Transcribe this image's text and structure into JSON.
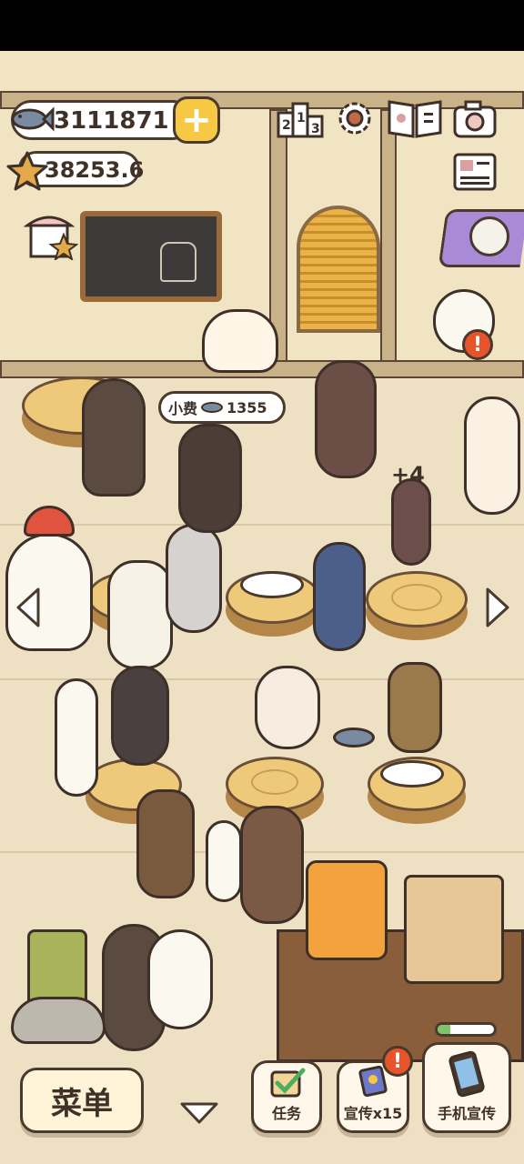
{
  "currency": {
    "fish_amount": "3111871",
    "star_amount": "38253.6",
    "add_symbol": "+"
  },
  "top_icons": [
    "ranking-icon",
    "settings-gear-icon",
    "recipe-book-icon",
    "camera-icon",
    "newspaper-icon"
  ],
  "tip_bubble": {
    "label": "小费",
    "amount": "1355"
  },
  "floating_bonus": "+4",
  "badge_symbol": "!",
  "bottom_bar": {
    "menu_label": "菜单",
    "tasks_label": "任务",
    "promote_label": "宣传x15",
    "phone_promote_label": "手机宣传"
  },
  "colors": {
    "wall": "#f1e4c2",
    "floor": "#eee1c3",
    "table_top": "#eec979",
    "outline": "#4a3a2e",
    "accent_yellow": "#f7c843",
    "accent_purple": "#a98ad6",
    "alert_orange": "#e8542a"
  }
}
